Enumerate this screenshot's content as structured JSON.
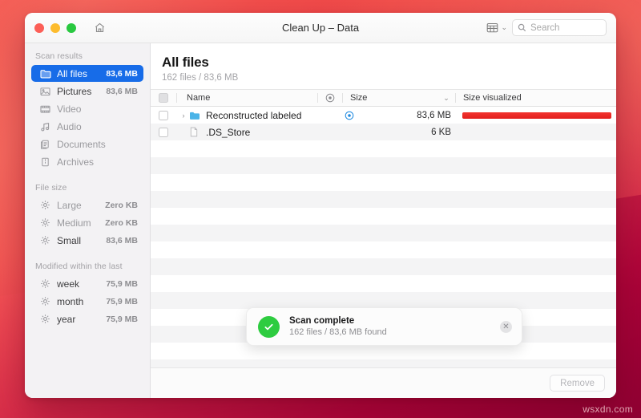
{
  "window": {
    "title": "Clean Up – Data",
    "traffic_lights": [
      "close",
      "minimize",
      "zoom"
    ],
    "home_icon": "home-icon",
    "view_toggle_icon": "grid-view-icon",
    "view_toggle_chevron": "⌄",
    "search": {
      "icon": "search-icon",
      "placeholder": "Search",
      "value": ""
    }
  },
  "sidebar": {
    "groups": [
      {
        "title": "Scan results",
        "items": [
          {
            "label": "All files",
            "value": "83,6 MB",
            "icon": "folder-icon",
            "active": true,
            "dim": false
          },
          {
            "label": "Pictures",
            "value": "83,6 MB",
            "icon": "picture-icon",
            "active": false,
            "dim": false
          },
          {
            "label": "Video",
            "value": "",
            "icon": "film-icon",
            "active": false,
            "dim": true
          },
          {
            "label": "Audio",
            "value": "",
            "icon": "music-icon",
            "active": false,
            "dim": true
          },
          {
            "label": "Documents",
            "value": "",
            "icon": "document-icon",
            "active": false,
            "dim": true
          },
          {
            "label": "Archives",
            "value": "",
            "icon": "archive-icon",
            "active": false,
            "dim": true
          }
        ]
      },
      {
        "title": "File size",
        "items": [
          {
            "label": "Large",
            "value": "Zero KB",
            "icon": "gear-icon",
            "active": false,
            "dim": true
          },
          {
            "label": "Medium",
            "value": "Zero KB",
            "icon": "gear-icon",
            "active": false,
            "dim": true
          },
          {
            "label": "Small",
            "value": "83,6 MB",
            "icon": "gear-icon",
            "active": false,
            "dim": false
          }
        ]
      },
      {
        "title": "Modified within the last",
        "items": [
          {
            "label": "week",
            "value": "75,9 MB",
            "icon": "gear-icon",
            "active": false,
            "dim": false
          },
          {
            "label": "month",
            "value": "75,9 MB",
            "icon": "gear-icon",
            "active": false,
            "dim": false
          },
          {
            "label": "year",
            "value": "75,9 MB",
            "icon": "gear-icon",
            "active": false,
            "dim": false
          }
        ]
      }
    ]
  },
  "main": {
    "title": "All files",
    "subtitle": "162 files / 83,6 MB",
    "table": {
      "columns": {
        "select_all": "",
        "name": "Name",
        "target_icon": "target-icon",
        "size": "Size",
        "sort_chevron": "⌄",
        "size_visualized": "Size visualized"
      },
      "rows": [
        {
          "checked": false,
          "expandable": true,
          "disclosure": "›",
          "icon": "folder-icon",
          "name": "Reconstructed labeled",
          "target": true,
          "size": "83,6 MB",
          "bar_percent": 100,
          "bar_color": "#e82c26"
        },
        {
          "checked": false,
          "expandable": false,
          "disclosure": "",
          "icon": "file-icon",
          "name": ".DS_Store",
          "target": false,
          "size": "6 KB",
          "bar_percent": 0,
          "bar_color": "#e82c26"
        }
      ],
      "empty_row_count": 14
    }
  },
  "toast": {
    "status_icon": "check-circle-icon",
    "title": "Scan complete",
    "message": "162 files / 83,6 MB found",
    "close_icon": "close-icon",
    "accent_color": "#2ecc40"
  },
  "footer": {
    "remove_label": "Remove",
    "remove_enabled": false
  },
  "watermark": "wsxdn.com"
}
